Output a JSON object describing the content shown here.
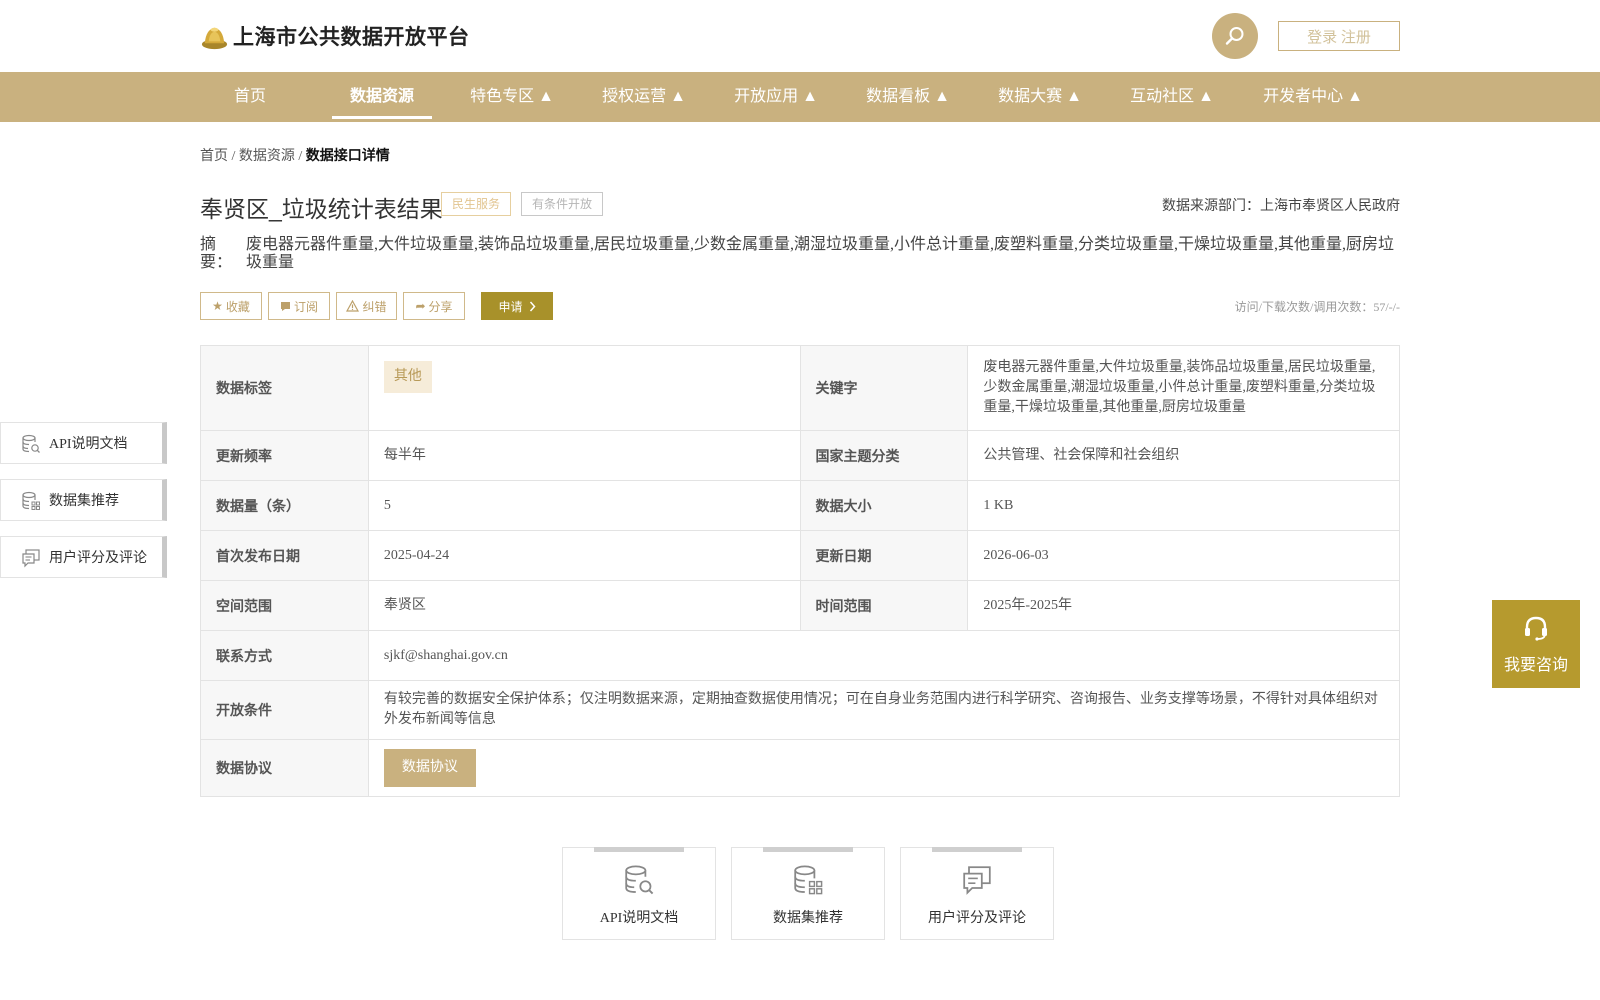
{
  "header": {
    "site_name": "上海市公共数据开放平台",
    "login_label": "登录 注册"
  },
  "nav": {
    "items": [
      {
        "label": "首页"
      },
      {
        "label": "数据资源"
      },
      {
        "label": "特色专区 ▲"
      },
      {
        "label": "授权运营 ▲"
      },
      {
        "label": "开放应用 ▲"
      },
      {
        "label": "数据看板 ▲"
      },
      {
        "label": "数据大赛 ▲"
      },
      {
        "label": "互动社区 ▲"
      },
      {
        "label": "开发者中心 ▲"
      }
    ],
    "active_index": 1
  },
  "breadcrumb": {
    "home": "首页",
    "sep": " / ",
    "section": "数据资源",
    "current": "数据接口详情"
  },
  "detail": {
    "title": "奉贤区_垃圾统计表结果",
    "tags": [
      "民生服务",
      "有条件开放"
    ],
    "source_dept": "数据来源部门：上海市奉贤区人民政府",
    "abstract_label_1": "摘",
    "abstract_label_2": "要：",
    "abstract_text": "废电器元器件重量,大件垃圾重量,装饰品垃圾重量,居民垃圾重量,少数金属重量,潮湿垃圾重量,小件总计重量,废塑料重量,分类垃圾重量,干燥垃圾重量,其他重量,厨房垃圾重量"
  },
  "actions": {
    "favorite": "收藏",
    "subscribe": "订阅",
    "report": "纠错",
    "share": "分享",
    "apply": "申请",
    "visit_count": "访问/下载次数/调用次数：57/-/-"
  },
  "table": {
    "data_tag_label": "数据标签",
    "data_tag_value": "其他",
    "keyword_label": "关键字",
    "keyword_value": "废电器元器件重量,大件垃圾重量,装饰品垃圾重量,居民垃圾重量,少数金属重量,潮湿垃圾重量,小件总计重量,废塑料重量,分类垃圾重量,干燥垃圾重量,其他重量,厨房垃圾重量",
    "update_freq_label": "更新频率",
    "update_freq_value": "每半年",
    "national_theme_label": "国家主题分类",
    "national_theme_value": "公共管理、社会保障和社会组织",
    "data_count_label": "数据量（条）",
    "data_count_value": "5",
    "data_size_label": "数据大小",
    "data_size_value": "1 KB",
    "first_publish_label": "首次发布日期",
    "first_publish_value": "2025-04-24",
    "update_date_label": "更新日期",
    "update_date_value": "2026-06-03",
    "space_label": "空间范围",
    "space_value": "奉贤区",
    "time_label": "时间范围",
    "time_value": "2025年-2025年",
    "contact_label": "联系方式",
    "contact_value": "sjkf@shanghai.gov.cn",
    "open_cond_label": "开放条件",
    "open_cond_value": "有较完善的数据安全保护体系；仅注明数据来源，定期抽查数据使用情况；可在自身业务范围内进行科学研究、咨询报告、业务支撑等场景，不得针对具体组织对外发布新闻等信息",
    "protocol_label": "数据协议",
    "protocol_button": "数据协议"
  },
  "side_tabs": [
    "API说明文档",
    "数据集推荐",
    "用户评分及评论"
  ],
  "consult": "我要咨询",
  "bottom_cards": [
    "API说明文档",
    "数据集推荐",
    "用户评分及评论"
  ],
  "colors": {
    "brand_gold": "#c9b17f",
    "apply_gold": "#a8912a",
    "consult_gold": "#b69a2e"
  },
  "icons": {
    "logo": "gold-ingot-logo-icon",
    "search": "search-icon",
    "favorite": "star-icon",
    "subscribe": "bookmark-icon",
    "report": "warning-icon",
    "share": "share-arrow-icon",
    "apply": "chevron-right-icon",
    "api_doc": "database-search-icon",
    "dataset": "database-grid-icon",
    "comment": "chat-bubbles-icon",
    "consult": "headset-icon"
  }
}
